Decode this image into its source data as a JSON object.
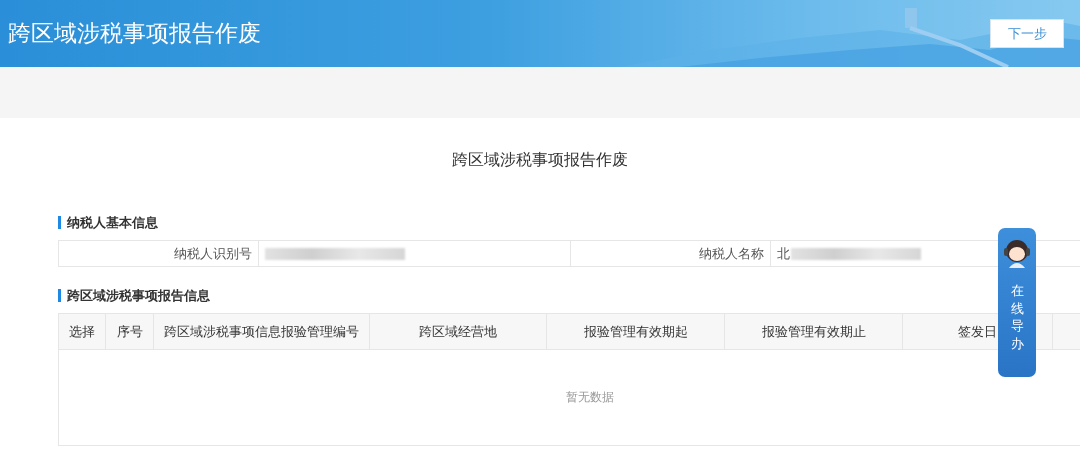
{
  "header": {
    "title": "跨区域涉税事项报告作废",
    "next_button": "下一步"
  },
  "page_title": "跨区域涉税事项报告作废",
  "taxpayer_section": {
    "title": "纳税人基本信息",
    "fields": [
      {
        "label": "纳税人识别号"
      },
      {
        "label": "纳税人名称",
        "value": "北"
      }
    ]
  },
  "report_section": {
    "title": "跨区域涉税事项报告信息",
    "columns": [
      "选择",
      "序号",
      "跨区域涉税事项信息报验管理编号",
      "跨区域经营地",
      "报验管理有效期起",
      "报验管理有效期止",
      "签发日"
    ],
    "empty_text": "暂无数据"
  },
  "help_widget": {
    "label": "在线导办"
  }
}
